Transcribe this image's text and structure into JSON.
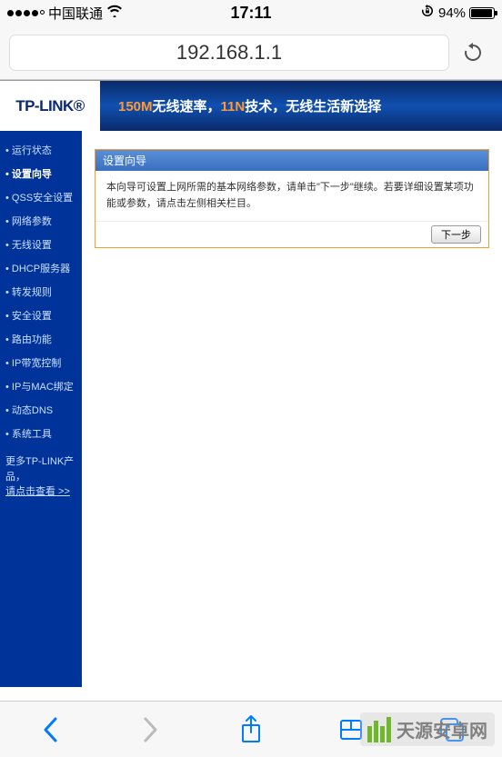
{
  "status_bar": {
    "carrier": "中国联通",
    "time": "17:11",
    "battery_pct": "94%"
  },
  "address_bar": {
    "url": "192.168.1.1"
  },
  "router": {
    "logo": "TP-LINK®",
    "banner_prefix": "150M",
    "banner_mid1": "无线速率，",
    "banner_11n": "11N",
    "banner_rest": "技术，无线生活新选择",
    "sidebar_items": [
      "运行状态",
      "设置向导",
      "QSS安全设置",
      "网络参数",
      "无线设置",
      "DHCP服务器",
      "转发规则",
      "安全设置",
      "路由功能",
      "IP带宽控制",
      "IP与MAC绑定",
      "动态DNS",
      "系统工具"
    ],
    "sidebar_active_index": 1,
    "sidebar_footer_line1": "更多TP-LINK产品，",
    "sidebar_footer_link": "请点击查看 >>",
    "panel": {
      "title": "设置向导",
      "body": "本向导可设置上网所需的基本网络参数，请单击\"下一步\"继续。若要详细设置某项功能或参数，请点击左侧相关栏目。",
      "next_label": "下一步"
    }
  },
  "watermark": {
    "text": "天源安卓网"
  }
}
